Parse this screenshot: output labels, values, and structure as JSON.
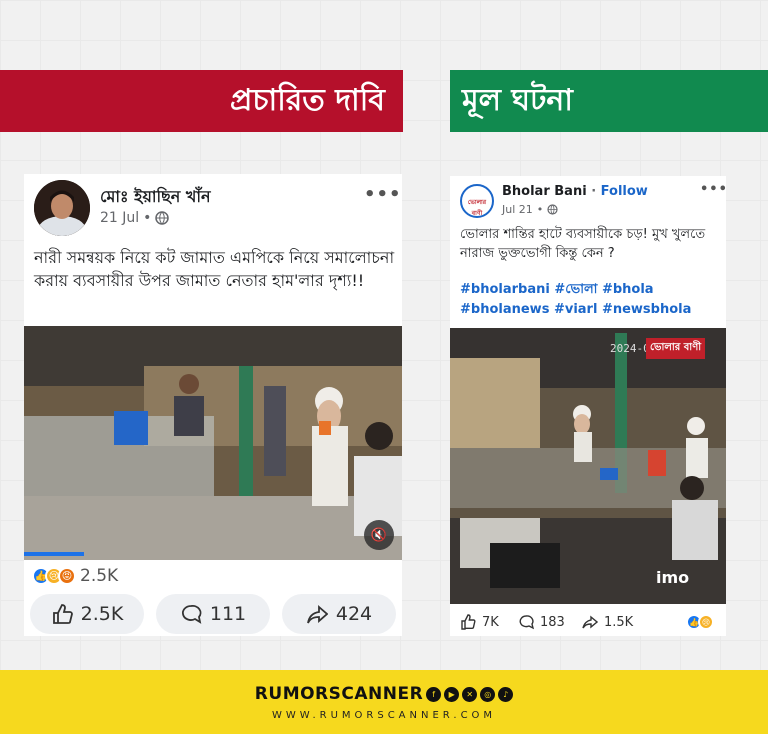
{
  "banners": {
    "claim": "প্রচারিত দাবি",
    "fact": "মূল ঘটনা"
  },
  "left_post": {
    "author": "মোঃ ইয়াছিন খাঁন",
    "date": "21 Jul",
    "text": "নারী সমন্বয়ক নিয়ে কট জামাত এমপিকে নিয়ে সমালোচনা করায় ব্যবসায়ীর উপর জামাত নেতার হাম'লার দৃশ্য!!",
    "reaction_count": "2.5K",
    "likes": "2.5K",
    "comments": "111",
    "shares": "424"
  },
  "right_post": {
    "page_name": "Bholar Bani",
    "follow_label": "Follow",
    "date": "Jul 21",
    "avatar_text": "ভোলার বাণী",
    "text": "ভোলার শান্তির হাটে ব্যবসায়ীকে চড়! মুখ খুলতে নারাজ ভুক্তভোগী কিন্তু কেন ?",
    "hashtags_line1": "#bholarbani #ভোলা #bhola",
    "hashtags_line2": "#bholanews #viarl #newsbhola",
    "video_timestamp": "2024-0",
    "video_logo": "ভোলার বাণী",
    "watermark": "imo",
    "likes": "7K",
    "comments": "183",
    "shares": "1.5K"
  },
  "footer": {
    "brand": "RUMORSCANNER",
    "url": "WWW.RUMORSCANNER.COM"
  },
  "colors": {
    "claim": "#b5102b",
    "fact": "#118a4f",
    "footer": "#f6d91e",
    "link": "#1b66c9"
  }
}
